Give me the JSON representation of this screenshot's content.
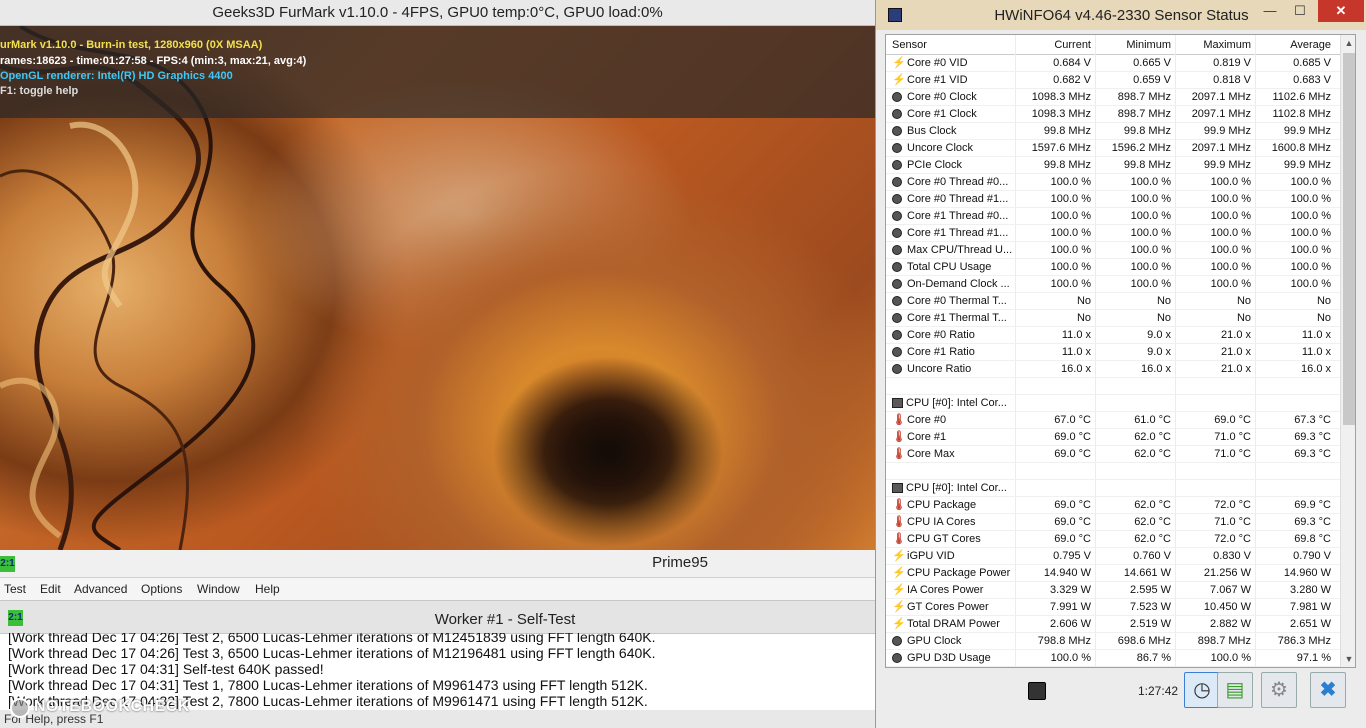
{
  "furmark": {
    "title": "Geeks3D FurMark v1.10.0 - 4FPS, GPU0 temp:0°C, GPU0 load:0%",
    "overlay": {
      "line1": "urMark v1.10.0 - Burn-in test, 1280x960 (0X MSAA)",
      "line2": "rames:18623 - time:01:27:58 - FPS:4 (min:3, max:21, avg:4)",
      "line3": "OpenGL renderer: Intel(R) HD Graphics 4400",
      "line4": "F1: toggle help"
    }
  },
  "prime95": {
    "title": "Prime95",
    "icon_label": "2:1",
    "menu": [
      "Test",
      "Edit",
      "Advanced",
      "Options",
      "Window",
      "Help"
    ],
    "worker": {
      "title": "Worker #1 - Self-Test",
      "icon_label": "2:1",
      "log": [
        "[Work thread Dec 17 04:26] Test 2, 6500 Lucas-Lehmer iterations of M12451839 using FFT length 640K.",
        "[Work thread Dec 17 04:26] Test 3, 6500 Lucas-Lehmer iterations of M12196481 using FFT length 640K.",
        "[Work thread Dec 17 04:31] Self-test 640K passed!",
        "[Work thread Dec 17 04:31] Test 1, 7800 Lucas-Lehmer iterations of M9961473 using FFT length 512K.",
        "[Work thread Dec 17 04:32] Test 2, 7800 Lucas-Lehmer iterations of M9961471 using FFT length 512K."
      ]
    },
    "status_bar": "For Help, press F1"
  },
  "watermark": {
    "text": "NOTEBOOKCHECK"
  },
  "hwinfo": {
    "title": "HWiNFO64 v4.46-2330 Sensor Status",
    "window_buttons": {
      "minimize": "—",
      "maximize": "☐",
      "close": "✕"
    },
    "columns": [
      "Sensor",
      "Current",
      "Minimum",
      "Maximum",
      "Average"
    ],
    "rows": [
      {
        "icon": "volt",
        "name": "Core #0 VID",
        "cur": "0.684 V",
        "min": "0.665 V",
        "max": "0.819 V",
        "avg": "0.685 V"
      },
      {
        "icon": "volt",
        "name": "Core #1 VID",
        "cur": "0.682 V",
        "min": "0.659 V",
        "max": "0.818 V",
        "avg": "0.683 V"
      },
      {
        "icon": "gauge",
        "name": "Core #0 Clock",
        "cur": "1098.3 MHz",
        "min": "898.7 MHz",
        "max": "2097.1 MHz",
        "avg": "1102.6 MHz"
      },
      {
        "icon": "gauge",
        "name": "Core #1 Clock",
        "cur": "1098.3 MHz",
        "min": "898.7 MHz",
        "max": "2097.1 MHz",
        "avg": "1102.8 MHz"
      },
      {
        "icon": "gauge",
        "name": "Bus Clock",
        "cur": "99.8 MHz",
        "min": "99.8 MHz",
        "max": "99.9 MHz",
        "avg": "99.9 MHz"
      },
      {
        "icon": "gauge",
        "name": "Uncore Clock",
        "cur": "1597.6 MHz",
        "min": "1596.2 MHz",
        "max": "2097.1 MHz",
        "avg": "1600.8 MHz"
      },
      {
        "icon": "gauge",
        "name": "PCIe Clock",
        "cur": "99.8 MHz",
        "min": "99.8 MHz",
        "max": "99.9 MHz",
        "avg": "99.9 MHz"
      },
      {
        "icon": "gauge",
        "name": "Core #0 Thread #0...",
        "cur": "100.0 %",
        "min": "100.0 %",
        "max": "100.0 %",
        "avg": "100.0 %"
      },
      {
        "icon": "gauge",
        "name": "Core #0 Thread #1...",
        "cur": "100.0 %",
        "min": "100.0 %",
        "max": "100.0 %",
        "avg": "100.0 %"
      },
      {
        "icon": "gauge",
        "name": "Core #1 Thread #0...",
        "cur": "100.0 %",
        "min": "100.0 %",
        "max": "100.0 %",
        "avg": "100.0 %"
      },
      {
        "icon": "gauge",
        "name": "Core #1 Thread #1...",
        "cur": "100.0 %",
        "min": "100.0 %",
        "max": "100.0 %",
        "avg": "100.0 %"
      },
      {
        "icon": "gauge",
        "name": "Max CPU/Thread U...",
        "cur": "100.0 %",
        "min": "100.0 %",
        "max": "100.0 %",
        "avg": "100.0 %"
      },
      {
        "icon": "gauge",
        "name": "Total CPU Usage",
        "cur": "100.0 %",
        "min": "100.0 %",
        "max": "100.0 %",
        "avg": "100.0 %"
      },
      {
        "icon": "gauge",
        "name": "On-Demand Clock ...",
        "cur": "100.0 %",
        "min": "100.0 %",
        "max": "100.0 %",
        "avg": "100.0 %"
      },
      {
        "icon": "gauge",
        "name": "Core #0 Thermal T...",
        "cur": "No",
        "min": "No",
        "max": "No",
        "avg": "No"
      },
      {
        "icon": "gauge",
        "name": "Core #1 Thermal T...",
        "cur": "No",
        "min": "No",
        "max": "No",
        "avg": "No"
      },
      {
        "icon": "gauge",
        "name": "Core #0 Ratio",
        "cur": "11.0 x",
        "min": "9.0 x",
        "max": "21.0 x",
        "avg": "11.0 x"
      },
      {
        "icon": "gauge",
        "name": "Core #1 Ratio",
        "cur": "11.0 x",
        "min": "9.0 x",
        "max": "21.0 x",
        "avg": "11.0 x"
      },
      {
        "icon": "gauge",
        "name": "Uncore Ratio",
        "cur": "16.0 x",
        "min": "16.0 x",
        "max": "21.0 x",
        "avg": "16.0 x"
      },
      {
        "icon": "blank",
        "name": "",
        "cur": "",
        "min": "",
        "max": "",
        "avg": ""
      },
      {
        "icon": "group",
        "name": "CPU [#0]: Intel Cor...",
        "cur": "",
        "min": "",
        "max": "",
        "avg": ""
      },
      {
        "icon": "temp",
        "name": "Core #0",
        "cur": "67.0 °C",
        "min": "61.0 °C",
        "max": "69.0 °C",
        "avg": "67.3 °C"
      },
      {
        "icon": "temp",
        "name": "Core #1",
        "cur": "69.0 °C",
        "min": "62.0 °C",
        "max": "71.0 °C",
        "avg": "69.3 °C"
      },
      {
        "icon": "temp",
        "name": "Core Max",
        "cur": "69.0 °C",
        "min": "62.0 °C",
        "max": "71.0 °C",
        "avg": "69.3 °C"
      },
      {
        "icon": "blank",
        "name": "",
        "cur": "",
        "min": "",
        "max": "",
        "avg": ""
      },
      {
        "icon": "group",
        "name": "CPU [#0]: Intel Cor...",
        "cur": "",
        "min": "",
        "max": "",
        "avg": ""
      },
      {
        "icon": "temp",
        "name": "CPU Package",
        "cur": "69.0 °C",
        "min": "62.0 °C",
        "max": "72.0 °C",
        "avg": "69.9 °C"
      },
      {
        "icon": "temp",
        "name": "CPU IA Cores",
        "cur": "69.0 °C",
        "min": "62.0 °C",
        "max": "71.0 °C",
        "avg": "69.3 °C"
      },
      {
        "icon": "temp",
        "name": "CPU GT Cores",
        "cur": "69.0 °C",
        "min": "62.0 °C",
        "max": "72.0 °C",
        "avg": "69.8 °C"
      },
      {
        "icon": "volt",
        "name": "iGPU VID",
        "cur": "0.795 V",
        "min": "0.760 V",
        "max": "0.830 V",
        "avg": "0.790 V"
      },
      {
        "icon": "volt",
        "name": "CPU Package Power",
        "cur": "14.940 W",
        "min": "14.661 W",
        "max": "21.256 W",
        "avg": "14.960 W"
      },
      {
        "icon": "volt",
        "name": "IA Cores Power",
        "cur": "3.329 W",
        "min": "2.595 W",
        "max": "7.067 W",
        "avg": "3.280 W"
      },
      {
        "icon": "volt",
        "name": "GT Cores Power",
        "cur": "7.991 W",
        "min": "7.523 W",
        "max": "10.450 W",
        "avg": "7.981 W"
      },
      {
        "icon": "volt",
        "name": "Total DRAM Power",
        "cur": "2.606 W",
        "min": "2.519 W",
        "max": "2.882 W",
        "avg": "2.651 W"
      },
      {
        "icon": "gauge",
        "name": "GPU Clock",
        "cur": "798.8 MHz",
        "min": "698.6 MHz",
        "max": "898.7 MHz",
        "avg": "786.3 MHz"
      },
      {
        "icon": "gauge",
        "name": "GPU D3D Usage",
        "cur": "100.0 %",
        "min": "86.7 %",
        "max": "100.0 %",
        "avg": "97.1 %"
      }
    ],
    "bottom": {
      "elapsed": "1:27:42"
    }
  }
}
